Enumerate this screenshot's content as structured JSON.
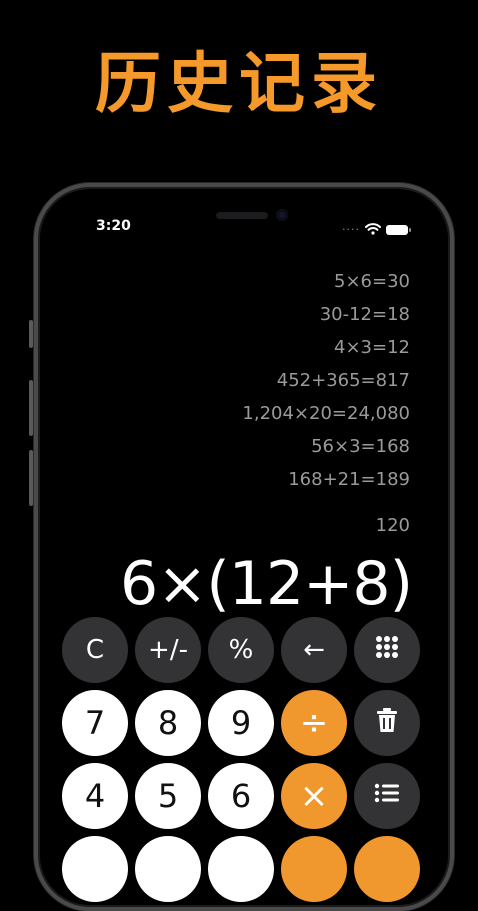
{
  "headline": "历史记录",
  "status": {
    "time": "3:20",
    "dots": "····"
  },
  "history": [
    "5×6=30",
    "30-12=18",
    "4×3=12",
    "452+365=817",
    "1,204×20=24,080",
    "56×3=168",
    "168+21=189"
  ],
  "previous_result": "120",
  "expression": "6×(12+8)",
  "keys": {
    "clear": "C",
    "sign": "+/-",
    "percent": "%",
    "backspace": "←",
    "seven": "7",
    "eight": "8",
    "nine": "9",
    "divide": "÷",
    "four": "4",
    "five": "5",
    "six": "6",
    "multiply": "×"
  },
  "icons": {
    "grid": "grid-icon",
    "trash": "trash-icon",
    "list": "list-icon",
    "wifi": "wifi-icon",
    "battery": "battery-icon"
  },
  "colors": {
    "accent": "#f59a2a",
    "operator": "#f0982e",
    "function_key": "#333336",
    "number_key": "#ffffff"
  }
}
